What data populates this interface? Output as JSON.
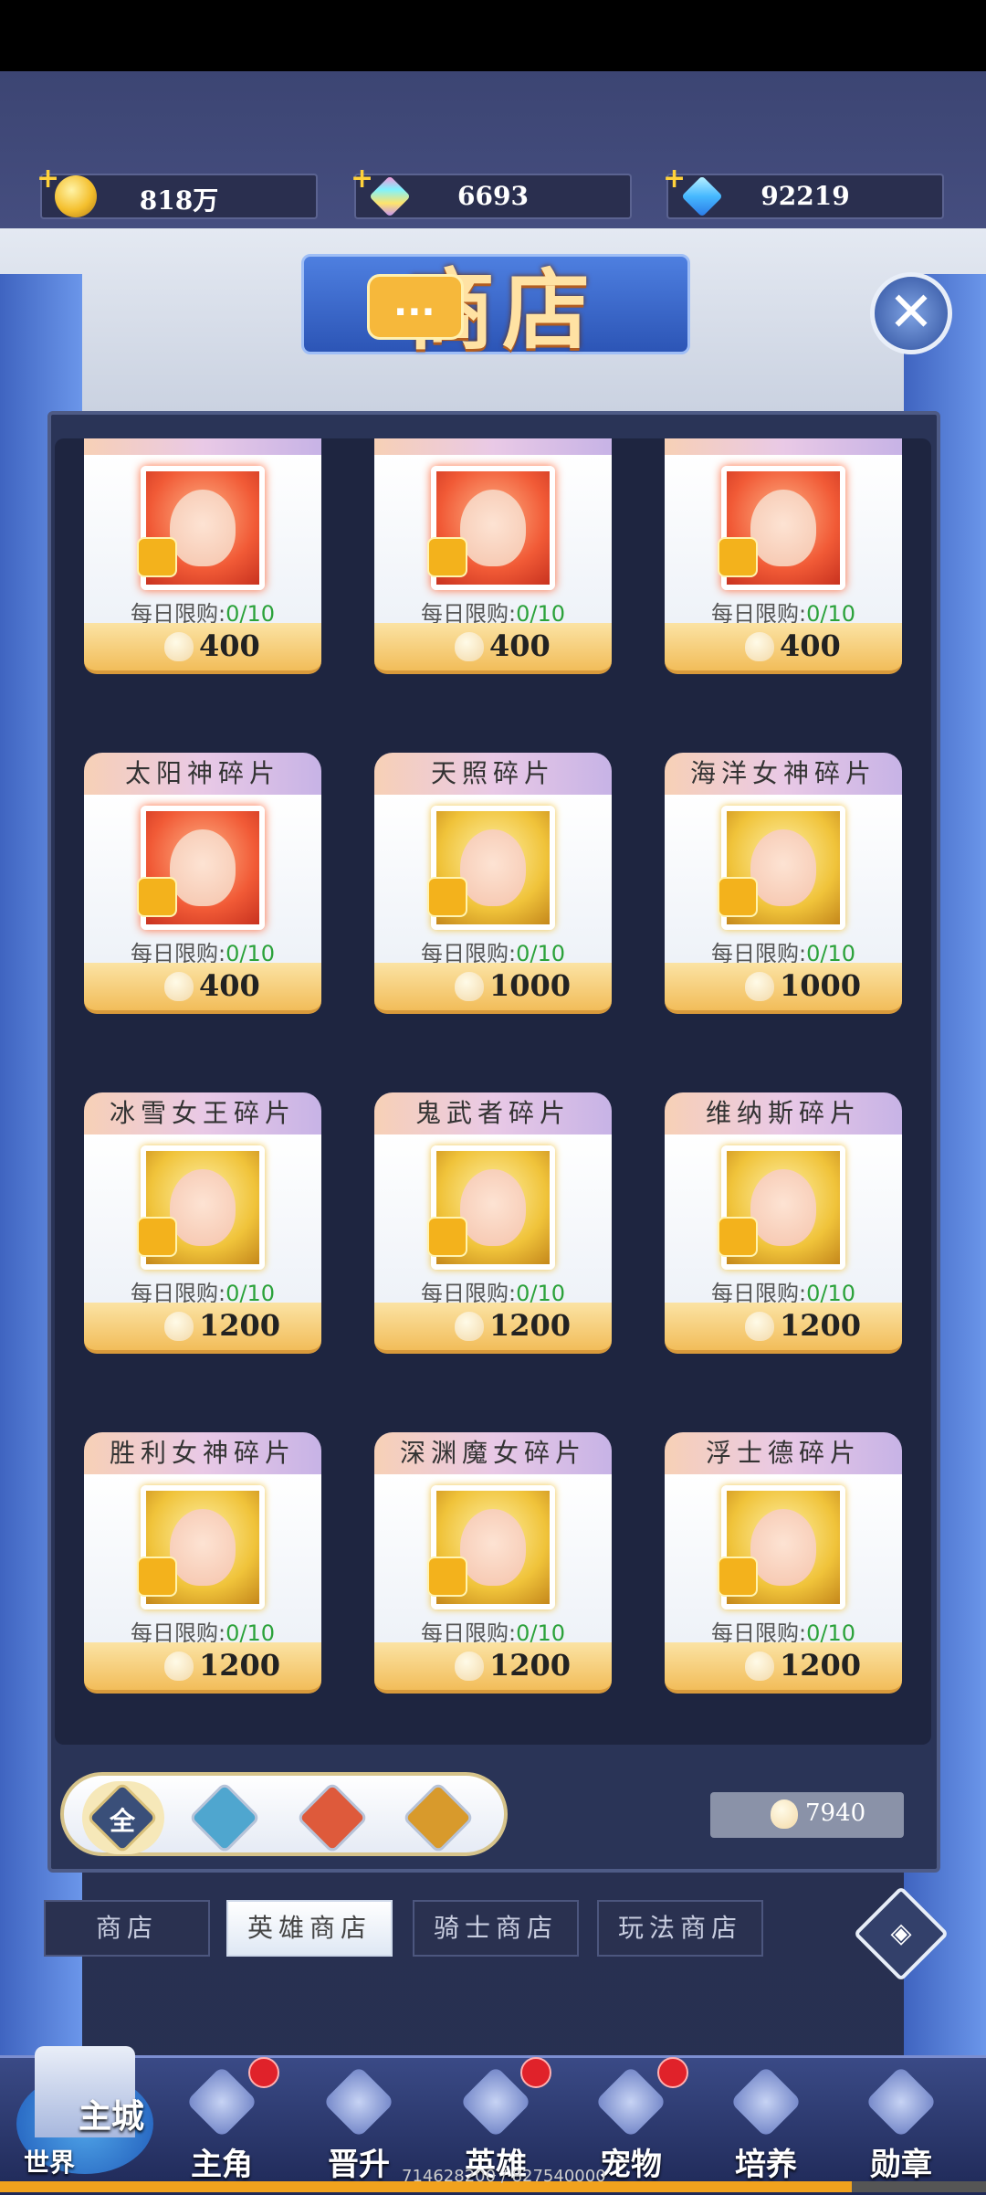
{
  "currencies": [
    {
      "icon": "gold-coin-icon",
      "value": "818万"
    },
    {
      "icon": "rainbow-crystal-icon",
      "value": "6693"
    },
    {
      "icon": "blue-diamond-icon",
      "value": "92219"
    }
  ],
  "banner": {
    "title": "商店",
    "chat": "..."
  },
  "close_label": "✕",
  "daily_limit_label": "每日限购:",
  "cards": [
    {
      "name": "",
      "limit": "0/10",
      "price": "400",
      "frame": "red"
    },
    {
      "name": "",
      "limit": "0/10",
      "price": "400",
      "frame": "red"
    },
    {
      "name": "",
      "limit": "0/10",
      "price": "400",
      "frame": "red"
    },
    {
      "name": "太阳神碎片",
      "limit": "0/10",
      "price": "400",
      "frame": "red"
    },
    {
      "name": "天照碎片",
      "limit": "0/10",
      "price": "1000",
      "frame": "gold"
    },
    {
      "name": "海洋女神碎片",
      "limit": "0/10",
      "price": "1000",
      "frame": "gold"
    },
    {
      "name": "冰雪女王碎片",
      "limit": "0/10",
      "price": "1200",
      "frame": "gold"
    },
    {
      "name": "鬼武者碎片",
      "limit": "0/10",
      "price": "1200",
      "frame": "gold"
    },
    {
      "name": "维纳斯碎片",
      "limit": "0/10",
      "price": "1200",
      "frame": "gold"
    },
    {
      "name": "胜利女神碎片",
      "limit": "0/10",
      "price": "1200",
      "frame": "gold"
    },
    {
      "name": "深渊魔女碎片",
      "limit": "0/10",
      "price": "1200",
      "frame": "gold"
    },
    {
      "name": "浮士德碎片",
      "limit": "0/10",
      "price": "1200",
      "frame": "gold"
    }
  ],
  "filters": [
    {
      "label": "全",
      "icon": "all-filter-icon"
    },
    {
      "label": "",
      "icon": "water-element-icon"
    },
    {
      "label": "",
      "icon": "fire-element-icon"
    },
    {
      "label": "",
      "icon": "earth-element-icon"
    }
  ],
  "balance": "7940",
  "tabs": [
    "商店",
    "英雄商店",
    "骑士商店",
    "玩法商店"
  ],
  "active_tab": "英雄商店",
  "nav": {
    "city_label": "主城",
    "world_label": "世界",
    "items": [
      "主角",
      "晋升",
      "英雄",
      "宠物",
      "培养",
      "勋章"
    ]
  },
  "progress": {
    "text": "714628200 / 827540000",
    "fraction": 0.864
  },
  "colors": {
    "accent": "#f2bd5a",
    "limit_count": "#2ba23a",
    "badge": "#e0222a"
  }
}
